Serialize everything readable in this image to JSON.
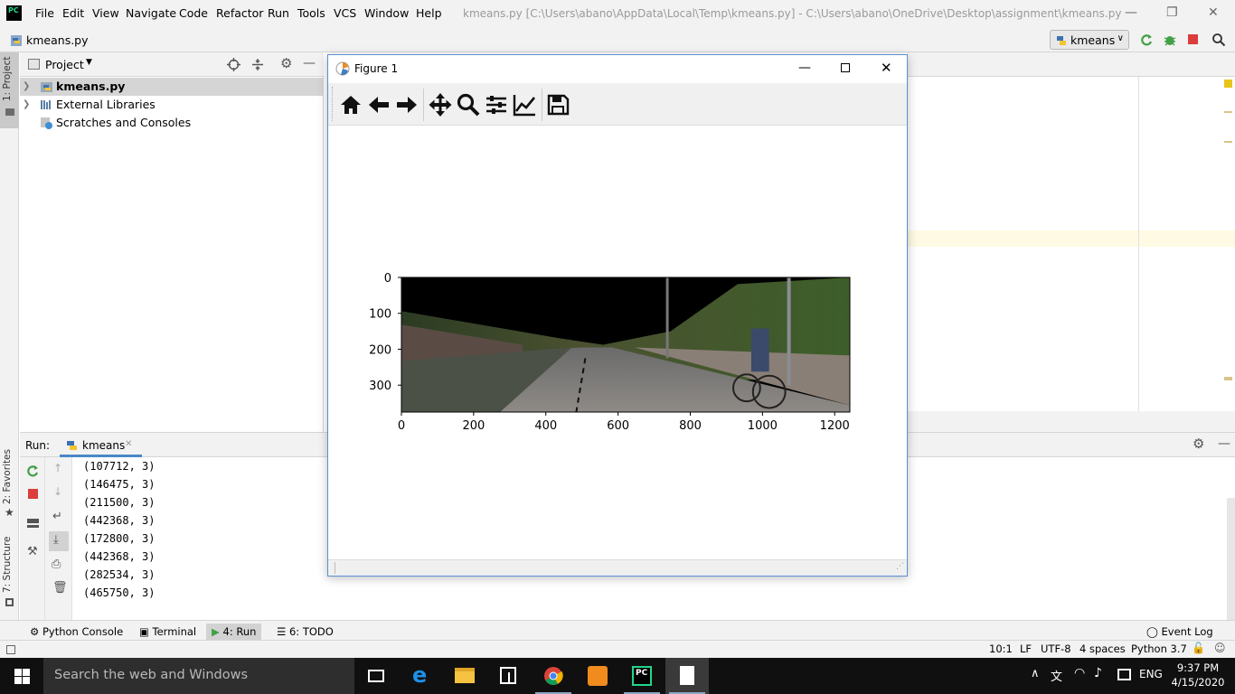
{
  "app": {
    "logo_text": "PC",
    "window_title": "kmeans.py [C:\\Users\\abano\\AppData\\Local\\Temp\\kmeans.py] - C:\\Users\\abano\\OneDrive\\Desktop\\assignment\\kmeans.py",
    "menu": [
      "File",
      "Edit",
      "View",
      "Navigate",
      "Code",
      "Refactor",
      "Run",
      "Tools",
      "VCS",
      "Window",
      "Help"
    ]
  },
  "navbar": {
    "breadcrumb_file": "kmeans.py",
    "run_config": "kmeans"
  },
  "left_stripe": {
    "project_tab": "1: Project",
    "favorites_tab": "2: Favorites",
    "structure_tab": "7: Structure"
  },
  "project_panel": {
    "title": "Project",
    "items": [
      {
        "label": "kmeans.py",
        "bold": true
      },
      {
        "label": "External Libraries"
      },
      {
        "label": "Scratches and Consoles"
      }
    ]
  },
  "run_panel": {
    "label": "Run:",
    "tab_label": "kmeans",
    "output": [
      "(107712, 3)",
      "(146475, 3)",
      "(211500, 3)",
      "(442368, 3)",
      "(172800, 3)",
      "(442368, 3)",
      "(282534, 3)",
      "(465750, 3)"
    ]
  },
  "tool_windows": {
    "python_console": "Python Console",
    "terminal": "Terminal",
    "run": "4: Run",
    "todo": "6: TODO",
    "event_log": "Event Log"
  },
  "status_bar": {
    "position": "10:1",
    "line_sep": "LF",
    "encoding": "UTF-8",
    "indent": "4 spaces",
    "interpreter": "Python 3.7"
  },
  "taskbar": {
    "search_placeholder": "Search the web and Windows",
    "language": "ENG",
    "time": "9:37 PM",
    "date": "4/15/2020"
  },
  "figure": {
    "title": "Figure 1",
    "toolbar": [
      "home-icon",
      "back-icon",
      "forward-icon",
      "pan-icon",
      "zoom-icon",
      "subplots-icon",
      "customize-icon",
      "save-icon"
    ],
    "image_kind": "street-scene-with-cyclist",
    "x_ticks": [
      "0",
      "200",
      "400",
      "600",
      "800",
      "1000",
      "1200"
    ],
    "y_ticks": [
      "0",
      "100",
      "200",
      "300"
    ]
  },
  "chart_data": {
    "type": "heatmap",
    "title": "",
    "xlabel": "",
    "ylabel": "",
    "xlim": [
      0,
      1242
    ],
    "ylim": [
      375,
      0
    ],
    "x_ticks": [
      0,
      200,
      400,
      600,
      800,
      1000,
      1200
    ],
    "y_ticks": [
      0,
      100,
      200,
      300
    ]
  }
}
